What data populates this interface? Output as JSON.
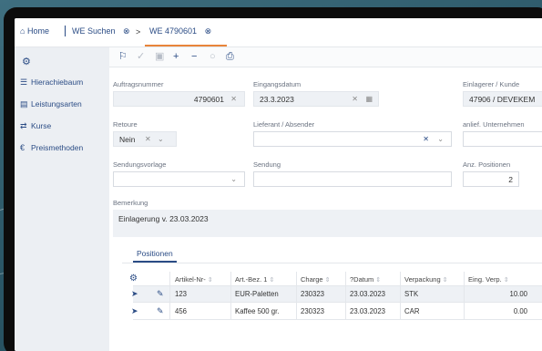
{
  "tabs": [
    {
      "label": "Home"
    },
    {
      "label": "WE Suchen",
      "close": "⊗"
    },
    {
      "label": "WE 4790601",
      "close": "⊗"
    }
  ],
  "breadcrumb_arrow": ">",
  "sidebar": {
    "items": [
      {
        "label": "Hierachiebaum",
        "icon": "tree-icon"
      },
      {
        "label": "Leistungsarten",
        "icon": "list-icon"
      },
      {
        "label": "Kurse",
        "icon": "exchange-icon"
      },
      {
        "label": "Preismethoden",
        "icon": "euro-icon"
      }
    ]
  },
  "form": {
    "auftragsnummer_label": "Auftragsnummer",
    "auftragsnummer": "4790601",
    "eingangsdatum_label": "Eingangsdatum",
    "eingangsdatum": "23.3.2023",
    "einlagerer_label": "Einlagerer / Kunde",
    "einlagerer": "47906 / DEVEKEM",
    "retoure_label": "Retoure",
    "retoure": "Nein",
    "lieferant_label": "Lieferant / Absender",
    "lieferant": "",
    "unternehmer_label": "anlief. Unternehmen",
    "sendungsvorlage_label": "Sendungsvorlage",
    "sendung_label": "Sendung",
    "anz_positionen_label": "Anz. Positionen",
    "anz_positionen": "2",
    "bemerkung_label": "Bemerkung",
    "bemerkung": "Einlagerung v. 23.03.2023"
  },
  "positions": {
    "tab_label": "Positionen",
    "columns": [
      "Artikel-Nr-",
      "Art.-Bez. 1",
      "Charge",
      "?Datum",
      "Verpackung",
      "Eing. Verp."
    ],
    "sort_glyph": "⇕",
    "rows": [
      {
        "artikel": "123",
        "bez": "EUR-Paletten",
        "charge": "230323",
        "datum": "23.03.2023",
        "verpackung": "STK",
        "eing": "10.00"
      },
      {
        "artikel": "456",
        "bez": "Kaffee 500 gr.",
        "charge": "230323",
        "datum": "23.03.2023",
        "verpackung": "CAR",
        "eing": "0.00"
      }
    ]
  },
  "colors": {
    "accent": "#2b4c85",
    "active_tab": "#e8843a"
  }
}
